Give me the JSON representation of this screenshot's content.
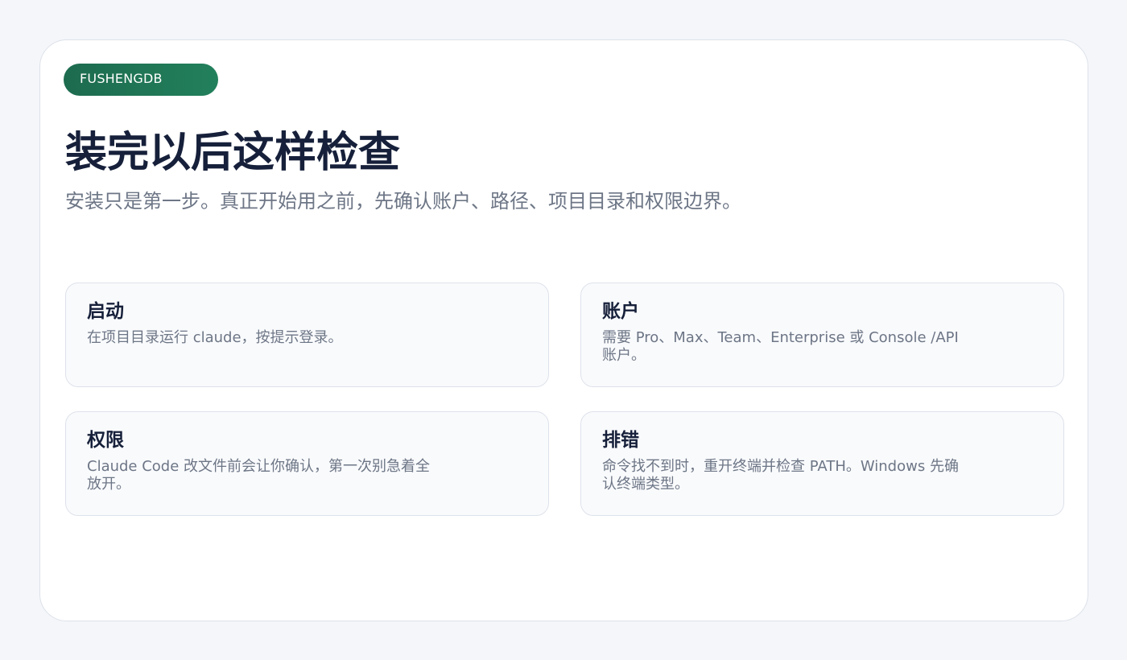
{
  "brand": {
    "label": "FUSHENGDB"
  },
  "header": {
    "title": "装完以后这样检查",
    "subtitle": "安装只是第一步。真正开始用之前，先确认账户、路径、项目目录和权限边界。"
  },
  "cards": [
    {
      "title": "启动",
      "body": "在项目目录运行 claude，按提示登录。"
    },
    {
      "title": "账户",
      "body": "需要 Pro、Max、Team、Enterprise 或 Console /API 账户。"
    },
    {
      "title": "权限",
      "body": "Claude Code 改文件前会让你确认，第一次别急着全放开。"
    },
    {
      "title": "排错",
      "body": "命令找不到时，重开终端并检查 PATH。Windows 先确认终端类型。"
    }
  ],
  "colors": {
    "brand": "#1d6b4f",
    "title": "#16203a",
    "muted": "#6d7686",
    "border": "#dde2ea",
    "page_bg": "#f4f6f9"
  }
}
